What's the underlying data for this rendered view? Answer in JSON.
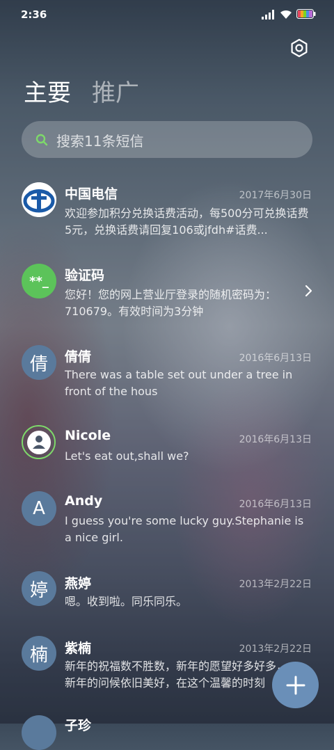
{
  "status": {
    "time": "2:36"
  },
  "tabs": {
    "main": "主要",
    "promo": "推广"
  },
  "search": {
    "placeholder": "搜索11条短信"
  },
  "messages": [
    {
      "name": "中国电信",
      "date": "2017年6月30日",
      "preview": "欢迎参加积分兑换话费活动，每500分可兑换话费5元，兑换话费请回复106或jfdh#话费...",
      "avatar": "",
      "avatar_icon": "china-telecom-logo"
    },
    {
      "name": "验证码",
      "date": "",
      "preview": "您好！您的网上营业厅登录的随机密码为：710679。有效时间为3分钟",
      "avatar": "**_",
      "avatar_color": "#5cc35a"
    },
    {
      "name": "倩倩",
      "date": "2016年6月13日",
      "preview": "There was a table set out under a tree in front of the hous",
      "avatar": "倩"
    },
    {
      "name": "Nicole",
      "date": "2016年6月13日",
      "preview": "Let's eat out,shall we?",
      "avatar": "",
      "avatar_icon": "person-icon"
    },
    {
      "name": "Andy",
      "date": "2016年6月13日",
      "preview": "I guess you're some lucky guy.Stephanie is a nice girl.",
      "avatar": "A"
    },
    {
      "name": "燕婷",
      "date": "2013年2月22日",
      "preview": "嗯。收到啦。同乐同乐。",
      "avatar": "婷"
    },
    {
      "name": "紫楠",
      "date": "2013年2月22日",
      "preview": "新年的祝福数不胜数，新年的愿望好多好多，新年的问候依旧美好，在这个温馨的时刻",
      "avatar": "楠"
    },
    {
      "name": "子珍",
      "date": "",
      "preview": "",
      "avatar": ""
    }
  ],
  "colors": {
    "accent": "#6a8fb8",
    "avatar_bg": "#5a7a9c",
    "verify_green": "#5cc35a",
    "telecom_blue": "#1a5aa8"
  }
}
